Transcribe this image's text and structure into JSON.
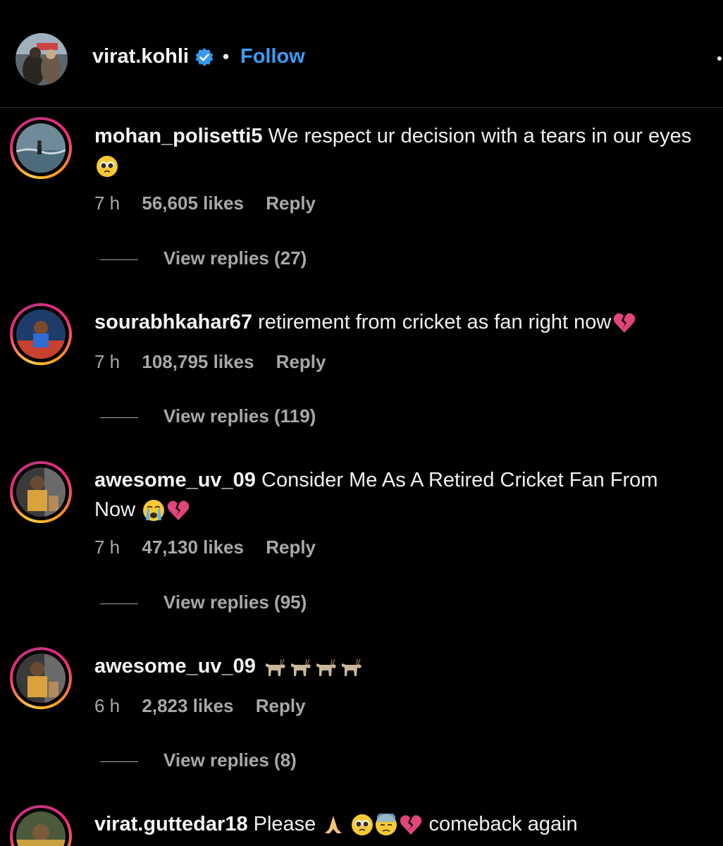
{
  "header": {
    "username": "virat.kohli",
    "separator": "•",
    "follow_label": "Follow"
  },
  "comments": [
    {
      "username": "mohan_polisetti5",
      "text": "We respect ur decision with a tears in our eyes",
      "emojis": [
        "pleading-face"
      ],
      "time": "7 h",
      "likes": "56,605 likes",
      "reply_label": "Reply",
      "view_replies": "View replies (27)"
    },
    {
      "username": "sourabhkahar67",
      "text": "retirement from cricket as fan right now",
      "emojis": [
        "broken-heart"
      ],
      "time": "7 h",
      "likes": "108,795 likes",
      "reply_label": "Reply",
      "view_replies": "View replies (119)"
    },
    {
      "username": "awesome_uv_09",
      "text": "Consider Me As A Retired Cricket Fan From Now ",
      "emojis": [
        "crying-face",
        "broken-heart"
      ],
      "time": "7 h",
      "likes": "47,130 likes",
      "reply_label": "Reply",
      "view_replies": "View replies (95)"
    },
    {
      "username": "awesome_uv_09",
      "text": "",
      "emojis": [
        "goat",
        "goat",
        "goat",
        "goat"
      ],
      "time": "6 h",
      "likes": "2,823 likes",
      "reply_label": "Reply",
      "view_replies": "View replies (8)"
    },
    {
      "username": "virat.guttedar18",
      "text": "Please",
      "text_after": "comeback again",
      "emojis": [
        "folded-hands",
        "pleading-face",
        "downcast-sweat-face",
        "broken-heart"
      ]
    }
  ],
  "colors": {
    "background": "#000000",
    "link": "#3a9df5",
    "secondary": "#a8a8a8",
    "verified": "#3897f0"
  }
}
